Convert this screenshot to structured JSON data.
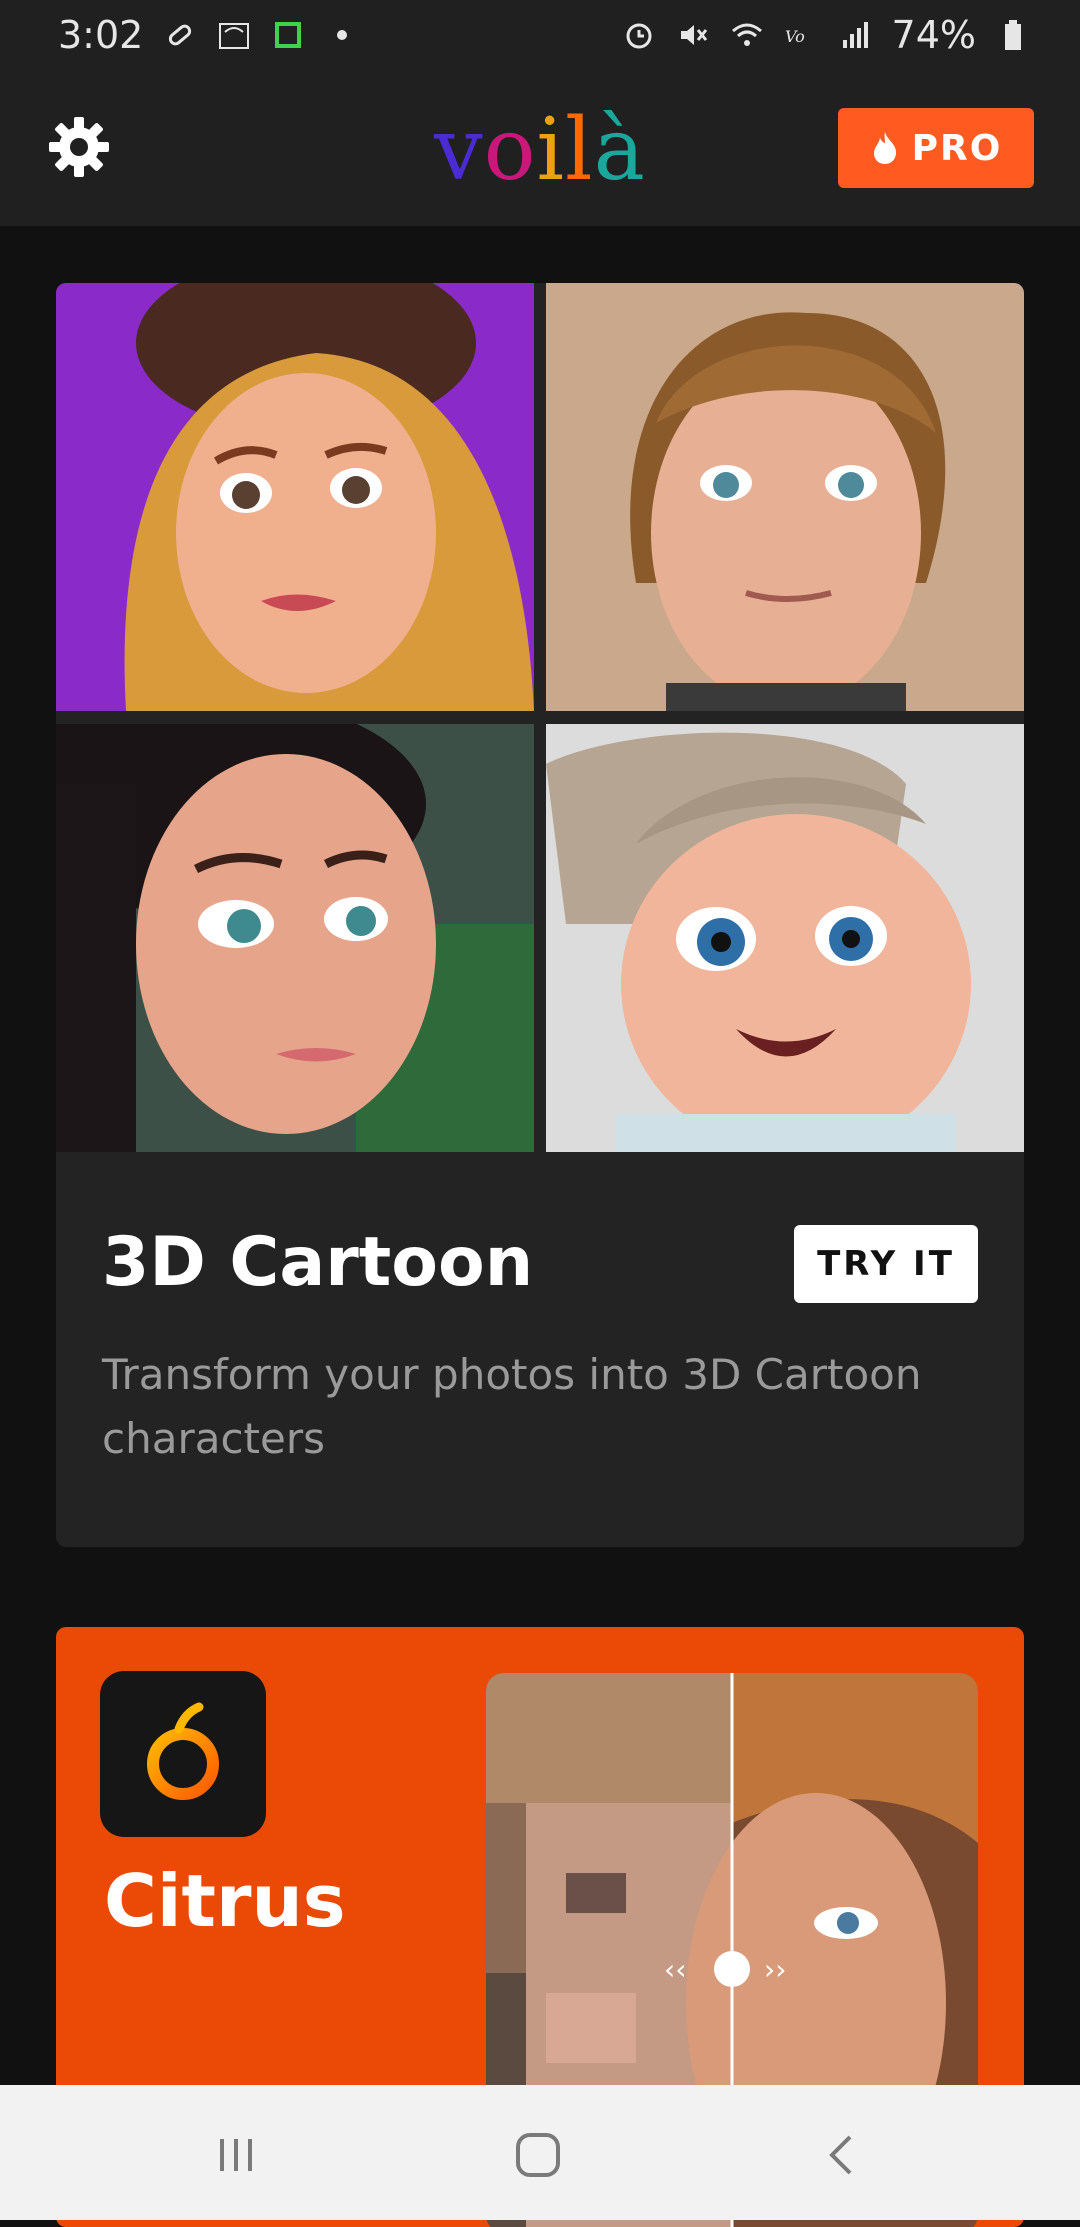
{
  "status_bar": {
    "time": "3:02",
    "battery": "74%",
    "icons": [
      "pill-icon",
      "voip-wifi-icon",
      "screen-record-icon",
      "dot-icon",
      "alarm-icon",
      "mute-icon",
      "wifi-icon",
      "volte-icon",
      "signal-icon",
      "battery-icon"
    ]
  },
  "app_bar": {
    "logo": [
      "v",
      "o",
      "i",
      "l",
      "à"
    ],
    "logo_colors": [
      "#4a2bd4",
      "#c9187a",
      "#e8a214",
      "#ff6a00",
      "#1aa79c"
    ],
    "pro_label": "PRO",
    "pro_color": "#ff5a1f"
  },
  "feature_card": {
    "title": "3D Cartoon",
    "button_label": "TRY IT",
    "description": "Transform your photos into 3D Cartoon characters"
  },
  "promo": {
    "app_name": "Citrus",
    "background": "#ea4a05"
  },
  "nav_bar": {
    "icons": [
      "recents-icon",
      "home-icon",
      "back-icon"
    ]
  }
}
